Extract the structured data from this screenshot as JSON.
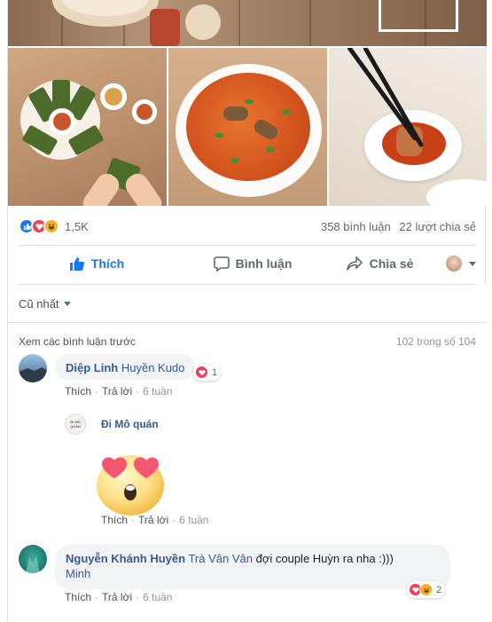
{
  "post": {
    "reaction_count": "1,5K",
    "comment_count": "358 bình luận",
    "share_count": "22 lượt chia sẻ"
  },
  "actions": {
    "like_label": "Thích",
    "comment_label": "Bình luận",
    "share_label": "Chia sẻ"
  },
  "comments": {
    "sort_label": "Cũ nhất",
    "view_previous": "Xem các bình luận trước",
    "count_label": "102 trong số 104",
    "items": [
      {
        "author": "Diệp Linh",
        "mention": "Huyền Kudo",
        "text": "",
        "reaction_count": "1",
        "like": "Thích",
        "reply": "Trả lời",
        "time": "6 tuần"
      },
      {
        "author": "Đi Mô quán",
        "avatar_text": "ĐI MÔ QUÁN",
        "like": "Thích",
        "reply": "Trả lời",
        "time": "6 tuần"
      },
      {
        "author": "Nguyễn Khánh Huyền",
        "mention": "Trà Vân Vân",
        "text": "đợi couple Huỳn ra nha :)))",
        "mention2": "Minh",
        "reaction_count": "2",
        "like": "Thích",
        "reply": "Trả lời",
        "time": "6 tuần"
      }
    ]
  },
  "colors": {
    "link": "#385898",
    "like_blue": "#1877f2",
    "love_red": "#f33e58",
    "haha_yellow": "#f7b125"
  }
}
